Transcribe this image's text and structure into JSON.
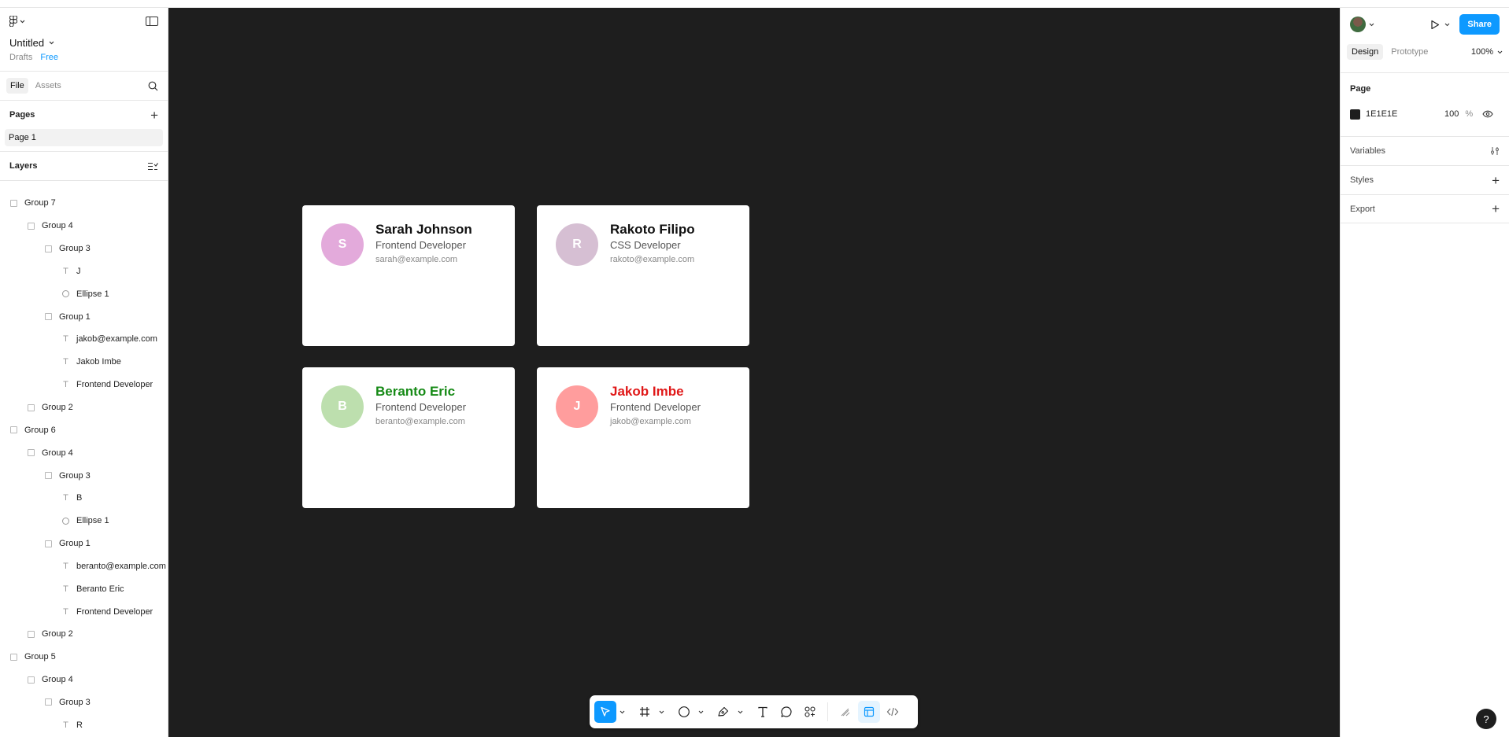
{
  "file": {
    "title": "Untitled",
    "location": "Drafts",
    "plan": "Free"
  },
  "left_tabs": {
    "file": "File",
    "assets": "Assets"
  },
  "pages": {
    "header": "Pages",
    "items": [
      "Page 1"
    ]
  },
  "layers": {
    "header": "Layers",
    "items": [
      {
        "label": "Group 7",
        "kind": "group",
        "depth": 0
      },
      {
        "label": "Group 4",
        "kind": "group",
        "depth": 1
      },
      {
        "label": "Group 3",
        "kind": "group",
        "depth": 2
      },
      {
        "label": "J",
        "kind": "text",
        "depth": 3
      },
      {
        "label": "Ellipse 1",
        "kind": "ellipse",
        "depth": 3
      },
      {
        "label": "Group 1",
        "kind": "group",
        "depth": 2
      },
      {
        "label": "jakob@example.com",
        "kind": "text",
        "depth": 3
      },
      {
        "label": "Jakob Imbe",
        "kind": "text",
        "depth": 3
      },
      {
        "label": "Frontend Developer",
        "kind": "text",
        "depth": 3
      },
      {
        "label": "Group 2",
        "kind": "group",
        "depth": 1
      },
      {
        "label": "Group 6",
        "kind": "group",
        "depth": 0
      },
      {
        "label": "Group 4",
        "kind": "group",
        "depth": 1
      },
      {
        "label": "Group 3",
        "kind": "group",
        "depth": 2
      },
      {
        "label": "B",
        "kind": "text",
        "depth": 3
      },
      {
        "label": "Ellipse 1",
        "kind": "ellipse",
        "depth": 3
      },
      {
        "label": "Group 1",
        "kind": "group",
        "depth": 2
      },
      {
        "label": "beranto@example.com",
        "kind": "text",
        "depth": 3
      },
      {
        "label": "Beranto Eric",
        "kind": "text",
        "depth": 3
      },
      {
        "label": "Frontend Developer",
        "kind": "text",
        "depth": 3
      },
      {
        "label": "Group 2",
        "kind": "group",
        "depth": 1
      },
      {
        "label": "Group 5",
        "kind": "group",
        "depth": 0
      },
      {
        "label": "Group 4",
        "kind": "group",
        "depth": 1
      },
      {
        "label": "Group 3",
        "kind": "group",
        "depth": 2
      },
      {
        "label": "R",
        "kind": "text",
        "depth": 3
      }
    ]
  },
  "cards": [
    {
      "initial": "S",
      "name": "Sarah Johnson",
      "role": "Frontend Developer",
      "email": "sarah@example.com",
      "avatar_color": "#e3aadb",
      "name_color": "#111111"
    },
    {
      "initial": "R",
      "name": "Rakoto  Filipo",
      "role": "CSS Developer",
      "email": "rakoto@example.com",
      "avatar_color": "#d6bfd3",
      "name_color": "#111111"
    },
    {
      "initial": "B",
      "name": "Beranto Eric",
      "role": "Frontend Developer",
      "email": "beranto@example.com",
      "avatar_color": "#bddfae",
      "name_color": "#168a16"
    },
    {
      "initial": "J",
      "name": "Jakob Imbe",
      "role": "Frontend Developer",
      "email": "jakob@example.com",
      "avatar_color": "#ff9d9d",
      "name_color": "#e01818"
    }
  ],
  "canvas": {
    "background": "#1e1e1e"
  },
  "right_panel": {
    "share_label": "Share",
    "tabs": {
      "design": "Design",
      "prototype": "Prototype"
    },
    "zoom": "100%",
    "page_section": "Page",
    "page_color_hex": "1E1E1E",
    "page_opacity": "100",
    "page_opacity_unit": "%",
    "variables": "Variables",
    "styles": "Styles",
    "export": "Export"
  },
  "help_label": "?"
}
